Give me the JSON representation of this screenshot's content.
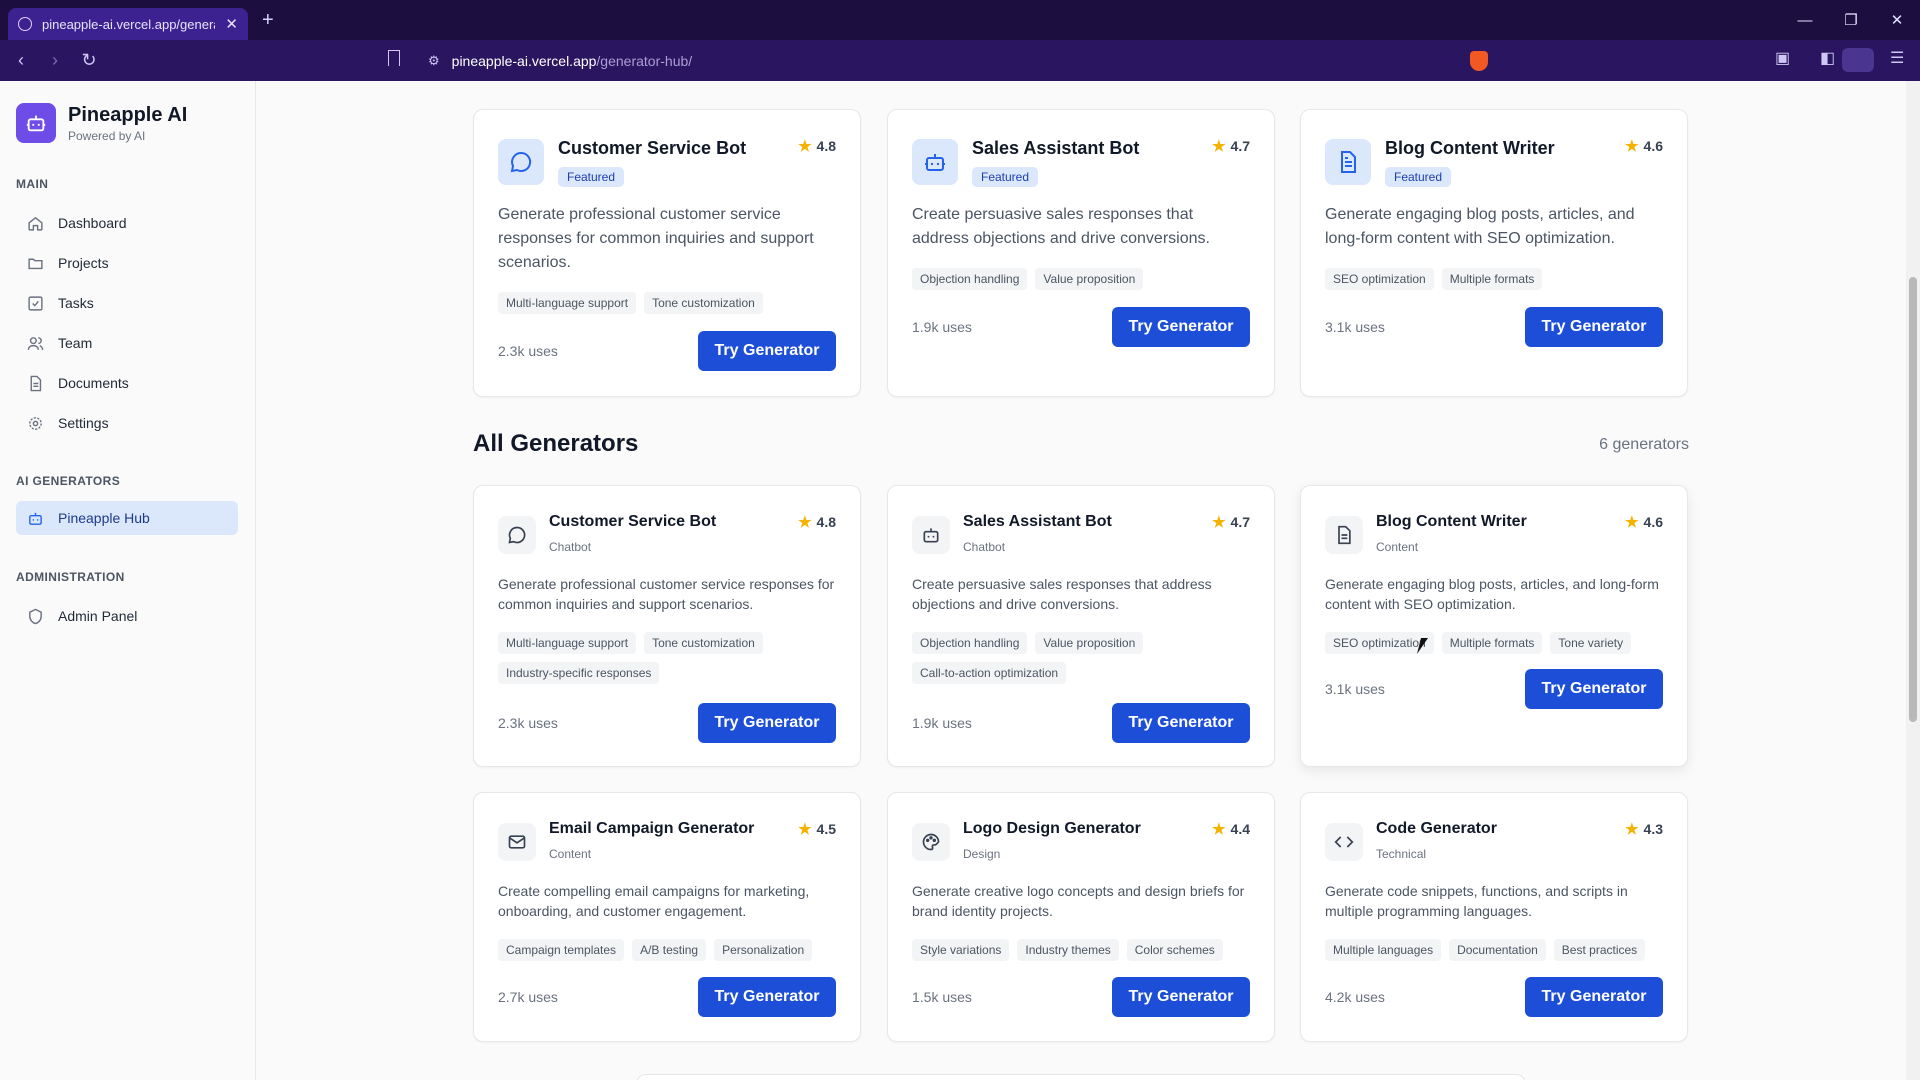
{
  "browser": {
    "tab_title": "pineapple-ai.vercel.app/generato",
    "url_host": "pineapple-ai.vercel.app",
    "url_path": "/generator-hub/"
  },
  "sidebar": {
    "brand_name": "Pineapple AI",
    "brand_sub": "Powered by AI",
    "sections": {
      "main": "MAIN",
      "ai_generators": "AI GENERATORS",
      "administration": "ADMINISTRATION"
    },
    "items": {
      "dashboard": "Dashboard",
      "projects": "Projects",
      "tasks": "Tasks",
      "team": "Team",
      "documents": "Documents",
      "settings": "Settings",
      "hub": "Pineapple Hub",
      "admin": "Admin Panel"
    }
  },
  "featured": [
    {
      "title": "Customer Service Bot",
      "rating": "4.8",
      "badge": "Featured",
      "description": "Generate professional customer service responses for common inquiries and support scenarios.",
      "tags": [
        "Multi-language support",
        "Tone customization"
      ],
      "uses": "2.3k uses",
      "button": "Try Generator",
      "icon": "chat-bubble-icon"
    },
    {
      "title": "Sales Assistant Bot",
      "rating": "4.7",
      "badge": "Featured",
      "description": "Create persuasive sales responses that address objections and drive conversions.",
      "tags": [
        "Objection handling",
        "Value proposition"
      ],
      "uses": "1.9k uses",
      "button": "Try Generator",
      "icon": "robot-icon"
    },
    {
      "title": "Blog Content Writer",
      "rating": "4.6",
      "badge": "Featured",
      "description": "Generate engaging blog posts, articles, and long-form content with SEO optimization.",
      "tags": [
        "SEO optimization",
        "Multiple formats"
      ],
      "uses": "3.1k uses",
      "button": "Try Generator",
      "icon": "document-icon"
    }
  ],
  "all": {
    "title": "All Generators",
    "count": "6 generators",
    "items": [
      {
        "title": "Customer Service Bot",
        "rating": "4.8",
        "category": "Chatbot",
        "description": "Generate professional customer service responses for common inquiries and support scenarios.",
        "tags": [
          "Multi-language support",
          "Tone customization",
          "Industry-specific responses"
        ],
        "uses": "2.3k uses",
        "button": "Try Generator",
        "icon": "chat-bubble-icon"
      },
      {
        "title": "Sales Assistant Bot",
        "rating": "4.7",
        "category": "Chatbot",
        "description": "Create persuasive sales responses that address objections and drive conversions.",
        "tags": [
          "Objection handling",
          "Value proposition",
          "Call-to-action optimization"
        ],
        "uses": "1.9k uses",
        "button": "Try Generator",
        "icon": "robot-icon"
      },
      {
        "title": "Blog Content Writer",
        "rating": "4.6",
        "category": "Content",
        "description": "Generate engaging blog posts, articles, and long-form content with SEO optimization.",
        "tags": [
          "SEO optimization",
          "Multiple formats",
          "Tone variety"
        ],
        "uses": "3.1k uses",
        "button": "Try Generator",
        "icon": "document-icon"
      },
      {
        "title": "Email Campaign Generator",
        "rating": "4.5",
        "category": "Content",
        "description": "Create compelling email campaigns for marketing, onboarding, and customer engagement.",
        "tags": [
          "Campaign templates",
          "A/B testing",
          "Personalization"
        ],
        "uses": "2.7k uses",
        "button": "Try Generator",
        "icon": "mail-icon"
      },
      {
        "title": "Logo Design Generator",
        "rating": "4.4",
        "category": "Design",
        "description": "Generate creative logo concepts and design briefs for brand identity projects.",
        "tags": [
          "Style variations",
          "Industry themes",
          "Color schemes"
        ],
        "uses": "1.5k uses",
        "button": "Try Generator",
        "icon": "palette-icon"
      },
      {
        "title": "Code Generator",
        "rating": "4.3",
        "category": "Technical",
        "description": "Generate code snippets, functions, and scripts in multiple programming languages.",
        "tags": [
          "Multiple languages",
          "Documentation",
          "Best practices"
        ],
        "uses": "4.2k uses",
        "button": "Try Generator",
        "icon": "code-brackets-icon"
      }
    ]
  },
  "colors": {
    "primary": "#1d4ed8",
    "brand": "#6d4ce8",
    "star": "#f5b301",
    "chrome": "#1c0f3f"
  }
}
